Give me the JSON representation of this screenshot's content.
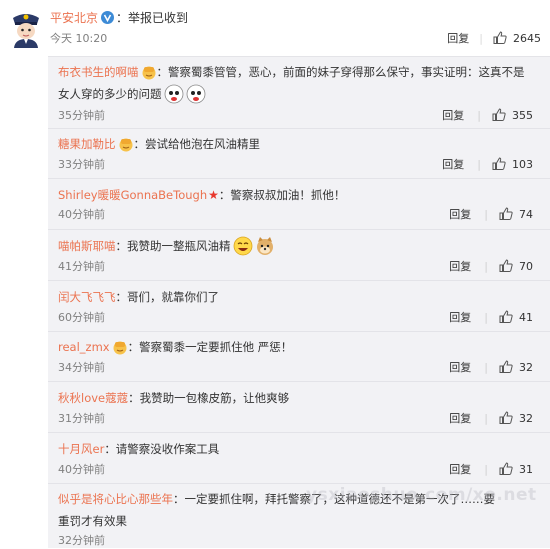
{
  "post": {
    "username": "平安北京",
    "text": "：举报已收到",
    "time": "今天 10:20",
    "reply_label": "回复",
    "like_count": "2645"
  },
  "comments": [
    {
      "user": "布衣书生的啊喵",
      "text": "：警察蜀黍管管，恶心，前面的妹子穿得那么保守，事实证明：这真不是女人穿的多少的问题",
      "time": "35分钟前",
      "reply": "回复",
      "likes": "355"
    },
    {
      "user": "糖果加勒比",
      "text": "：尝试给他泡在风油精里",
      "time": "33分钟前",
      "reply": "回复",
      "likes": "103"
    },
    {
      "user": "Shirley暖暖GonnaBeTough",
      "text": "：警察叔叔加油！抓他！",
      "time": "40分钟前",
      "reply": "回复",
      "likes": "74"
    },
    {
      "user": "喵帕斯耶喵",
      "text": "：我赞助一整瓶风油精",
      "time": "41分钟前",
      "reply": "回复",
      "likes": "70"
    },
    {
      "user": "闰大飞飞飞",
      "text": "：哥们，就靠你们了",
      "time": "60分钟前",
      "reply": "回复",
      "likes": "41"
    },
    {
      "user": "real_zmx",
      "text": "：警察蜀黍一定要抓住他 严惩！",
      "time": "34分钟前",
      "reply": "回复",
      "likes": "32"
    },
    {
      "user": "秋秋love蔻蔻",
      "text": "：我赞助一包橡皮筋，让他爽够",
      "time": "31分钟前",
      "reply": "回复",
      "likes": "32"
    },
    {
      "user": "十月风er",
      "text": "：请警察没收作案工具",
      "time": "40分钟前",
      "reply": "回复",
      "likes": "31"
    },
    {
      "user": "似乎是将心比心那些年",
      "text": "：一定要抓住啊，拜托警察了，这种道德还不是第一次了……要重罚才有效果",
      "time": "32分钟前",
      "reply": "",
      "likes": ""
    }
  ],
  "watermark": "ysxiaoshuo.com/xo.net",
  "colors": {
    "accent": "#eb7350",
    "panel": "#f2f2f5",
    "muted": "#808080"
  }
}
